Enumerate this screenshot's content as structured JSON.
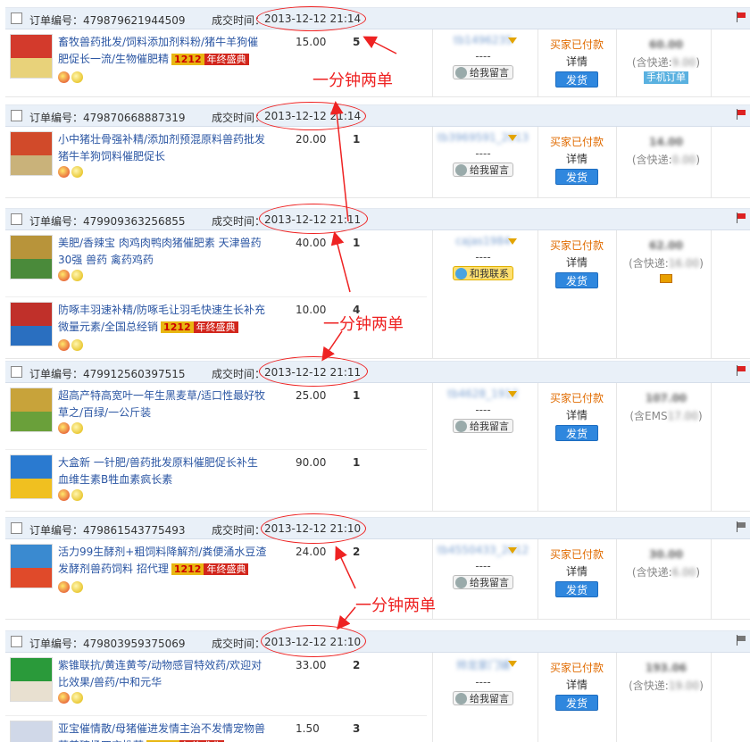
{
  "labels": {
    "order_no": "订单编号：",
    "deal_time": "成交时间：",
    "message": "给我留言",
    "contact": "和我联系",
    "status": "买家已付款",
    "details": "详情",
    "send": "发货",
    "dash": "----",
    "post_open": "(含快递:",
    "post_close": ")",
    "ems_open": "(含EMS",
    "mobile_order": "手机订单",
    "promo_1212": "1212",
    "promo_text": "年终盛典"
  },
  "orders": [
    {
      "no": "479879621944509",
      "time": "2013-12-12 21:14",
      "flag_color": "#d22",
      "buyer": "tb1496235",
      "total": "60.00",
      "post": "9.00",
      "post_type": "express",
      "items": [
        {
          "title": "畜牧兽药批发/饲料添加剂料粉/猪牛羊狗催肥促长一流/生物催肥精",
          "promo": true,
          "price": "15.00",
          "qty": "5"
        }
      ]
    },
    {
      "no": "479870668887319",
      "time": "2013-12-12 21:14",
      "flag_color": "#d22",
      "buyer": "tb3969591_2013",
      "total": "14.00",
      "post": "0.00",
      "post_type": "express",
      "items": [
        {
          "title": "小中猪壮骨强补精/添加剂预混原料兽药批发猪牛羊狗饲料催肥促长",
          "promo": false,
          "price": "20.00",
          "qty": "1"
        }
      ]
    },
    {
      "no": "479909363256855",
      "time": "2013-12-12 21:11",
      "flag_color": "#d22",
      "buyer": "cajas1984",
      "total": "62.00",
      "post": "16.00",
      "post_type": "express",
      "items": [
        {
          "title": "美肥/香辣宝 肉鸡肉鸭肉猪催肥素 天津兽药30强 兽药 禽药鸡药",
          "promo": false,
          "price": "40.00",
          "qty": "1"
        },
        {
          "title": "防啄丰羽速补精/防啄毛让羽毛快速生长补充微量元素/全国总经销",
          "promo": true,
          "price": "10.00",
          "qty": "4"
        }
      ]
    },
    {
      "no": "479912560397515",
      "time": "2013-12-12 21:11",
      "flag_color": "#d22",
      "buyer": "tb4628_1912",
      "total": "107.00",
      "post": "17.00",
      "post_type": "ems",
      "items": [
        {
          "title": "超高产特高宽叶一年生黑麦草/适口性最好牧草之/百绿/一公斤装",
          "promo": false,
          "price": "25.00",
          "qty": "1"
        },
        {
          "title": "大盒新 一针肥/兽药批发原料催肥促长补生血维生素B牲血素疯长素",
          "promo": false,
          "price": "90.00",
          "qty": "1"
        }
      ]
    },
    {
      "no": "479861543775493",
      "time": "2013-12-12 21:10",
      "flag_color": "#777",
      "buyer": "tb4550433_2012",
      "total": "30.00",
      "post": "6.00",
      "post_type": "express",
      "items": [
        {
          "title": "活力99生酵剂+粗饲料降解剂/粪便涌水豆渣发酵剂兽药饲料 招代理",
          "promo": true,
          "price": "24.00",
          "qty": "2"
        }
      ]
    },
    {
      "no": "479803959375069",
      "time": "2013-12-12 21:10",
      "flag_color": "#777",
      "buyer": "帅龙家门铺",
      "total": "193.06",
      "post": "19.00",
      "post_type": "express",
      "items": [
        {
          "title": "紫锥联抗/黄连黄芩/动物感冒特效药/欢迎对比效果/兽药/中和元华",
          "promo": false,
          "price": "33.00",
          "qty": "2"
        },
        {
          "title": "亚宝催情散/母猪催进发情主治不发情宠物兽药养殖场四宝推荐",
          "promo": true,
          "price": "1.50",
          "qty": "3"
        }
      ]
    }
  ],
  "annotations": [
    "一分钟两单",
    "一分钟两单",
    "一分钟两单"
  ],
  "colors": {
    "annotation": "#e22",
    "link": "#2b56a3",
    "status": "#e06b00",
    "button": "#2f87de"
  }
}
